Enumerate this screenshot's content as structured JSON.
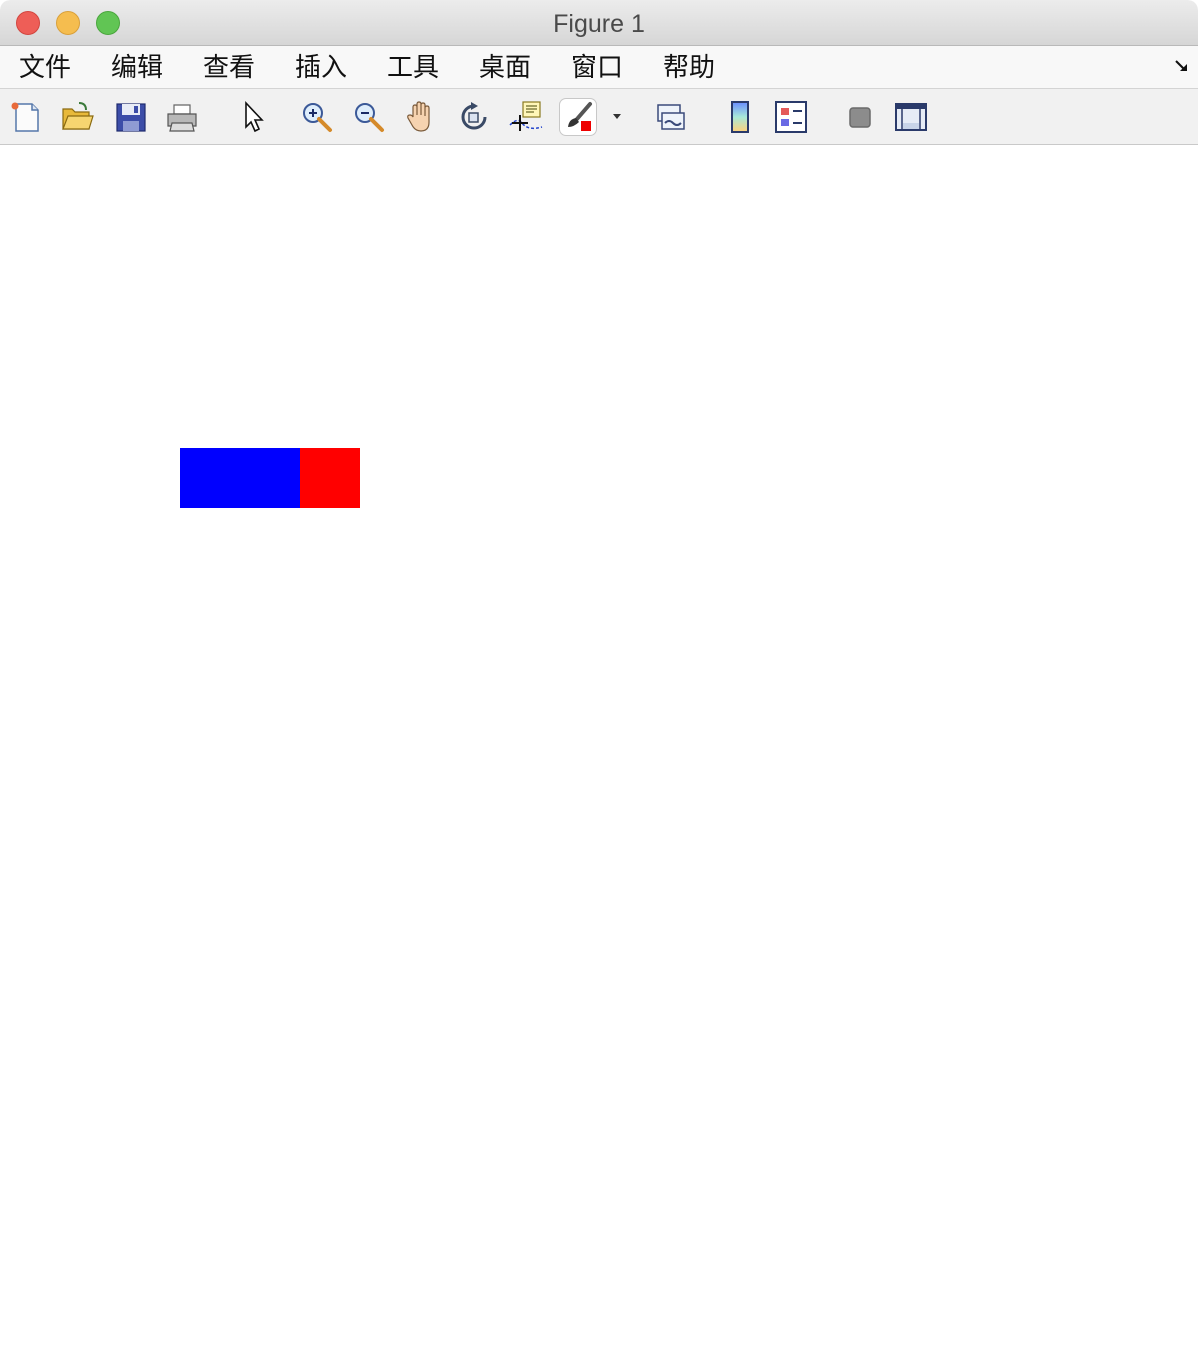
{
  "window": {
    "title": "Figure 1"
  },
  "menu": {
    "items": [
      {
        "label": "文件"
      },
      {
        "label": "编辑"
      },
      {
        "label": "查看"
      },
      {
        "label": "插入"
      },
      {
        "label": "工具"
      },
      {
        "label": "桌面"
      },
      {
        "label": "窗口"
      },
      {
        "label": "帮助"
      }
    ]
  },
  "toolbar": {
    "tools": [
      "new-figure-icon",
      "open-file-icon",
      "save-icon",
      "print-icon",
      "edit-plot-arrow-icon",
      "zoom-in-icon",
      "zoom-out-icon",
      "pan-hand-icon",
      "rotate-3d-icon",
      "data-cursor-icon",
      "brush-icon",
      "link-plot-icon",
      "colorbar-icon",
      "legend-icon",
      "hide-plot-tools-icon",
      "show-plot-tools-icon"
    ]
  },
  "figure": {
    "shapes": [
      {
        "name": "blue-rectangle",
        "color": "#0000ff"
      },
      {
        "name": "red-rectangle",
        "color": "#ff0000"
      }
    ]
  }
}
